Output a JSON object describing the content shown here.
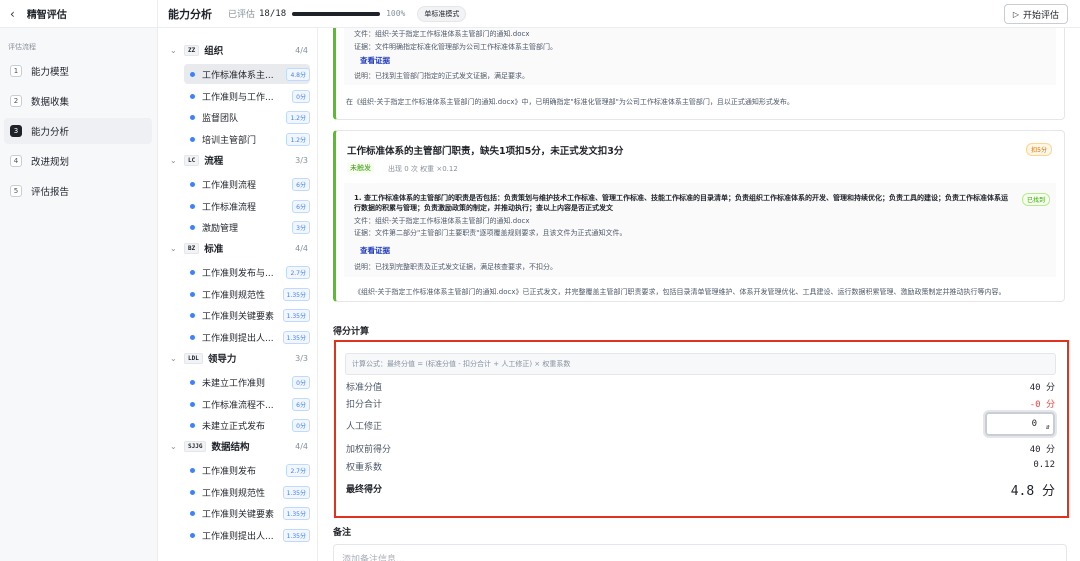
{
  "app": {
    "title": "精智评估"
  },
  "nav": {
    "section_label": "评估流程",
    "steps": [
      {
        "num": "1",
        "label": "能力模型"
      },
      {
        "num": "2",
        "label": "数据收集"
      },
      {
        "num": "3",
        "label": "能力分析"
      },
      {
        "num": "4",
        "label": "改进规划"
      },
      {
        "num": "5",
        "label": "评估报告"
      }
    ],
    "active_step": 2
  },
  "header": {
    "title": "能力分析",
    "evaluated_label": "已评估",
    "evaluated_count": "18/18",
    "progress_pct": "100%",
    "progress": 1.0,
    "mode_badge": "单标准模式",
    "start_button": "开始评估"
  },
  "tree": {
    "groups": [
      {
        "code": "ZZ",
        "name": "组织",
        "count": "4/4",
        "items": [
          {
            "name": "工作标准体系主...",
            "score": "4.8分"
          },
          {
            "name": "工作准则与工作...",
            "score": "0分"
          },
          {
            "name": "监督团队",
            "score": "1.2分"
          },
          {
            "name": "培训主管部门",
            "score": "1.2分"
          }
        ]
      },
      {
        "code": "LC",
        "name": "流程",
        "count": "3/3",
        "items": [
          {
            "name": "工作准则流程",
            "score": "6分"
          },
          {
            "name": "工作标准流程",
            "score": "6分"
          },
          {
            "name": "激励管理",
            "score": "3分"
          }
        ]
      },
      {
        "code": "BZ",
        "name": "标准",
        "count": "4/4",
        "items": [
          {
            "name": "工作准则发布与...",
            "score": "2.7分"
          },
          {
            "name": "工作准则规范性",
            "score": "1.35分"
          },
          {
            "name": "工作准则关键要素",
            "score": "1.35分"
          },
          {
            "name": "工作准则提出人...",
            "score": "1.35分"
          }
        ]
      },
      {
        "code": "LDL",
        "name": "领导力",
        "count": "3/3",
        "items": [
          {
            "name": "未建立工作准则",
            "score": "0分"
          },
          {
            "name": "工作标准流程不...",
            "score": "6分"
          },
          {
            "name": "未建立正式发布",
            "score": "0分"
          }
        ]
      },
      {
        "code": "SJJG",
        "name": "数据结构",
        "count": "4/4",
        "items": [
          {
            "name": "工作准则发布",
            "score": "2.7分"
          },
          {
            "name": "工作准则规范性",
            "score": "1.35分"
          },
          {
            "name": "工作准则关键要素",
            "score": "1.35分"
          },
          {
            "name": "工作准则提出人...",
            "score": "1.35分"
          }
        ]
      }
    ]
  },
  "card1": {
    "file": "文件：组织-关于指定工作标准体系主管部门的通知.docx",
    "evidence": "证据：文件明确指定标准化管理部为公司工作标准体系主管部门。",
    "link": "查看证据",
    "note": "说明：已找到主管部门指定的正式发文证据，满足要求。",
    "summary": "在《组织-关于指定工作标准体系主管部门的通知.docx》中，已明确指定\"标准化管理部\"为公司工作标准体系主管部门，且以正式通知形式发布。"
  },
  "card2": {
    "title": "工作标准体系的主管部门职责，缺失1项扣5分，未正式发文扣3分",
    "deduct_badge": "扣5分",
    "status_badge": "未触发",
    "meta": "出现 0 次  权重 ×0.12",
    "requirement": "1. 查工作标准体系的主管部门的职责是否包括：负责策划与维护技术工作标准、管理工作标准、技能工作标准的目录清单；负责组织工作标准体系的开发、管理和持续优化；负责工具的建设；负责工作标准体系运行数据的积累与管理；负责激励政策的制定，并推动执行；查以上内容是否正式发文",
    "found_badge": "已找到",
    "file": "文件：组织-关于指定工作标准体系主管部门的通知.docx",
    "evidence": "证据：文件第二部分\"主管部门主要职责\"逐项覆盖规则要求，且该文件为正式通知文件。",
    "link": "查看证据",
    "note": "说明：已找到完整职责及正式发文证据，满足核查要求，不扣分。",
    "summary": "《组织-关于指定工作标准体系主管部门的通知.docx》已正式发文，并完整覆盖主管部门职责要求，包括目录清单管理维护、体系开发管理优化、工具建设、运行数据积累管理、激励政策制定并推动执行等内容。"
  },
  "calc": {
    "title": "得分计算",
    "formula": "计算公式：最终分值 = (标准分值 - 扣分合计 + 人工修正) × 权重系数",
    "rows": [
      {
        "label": "标准分值",
        "value": "40 分"
      },
      {
        "label": "扣分合计",
        "value": "-0 分"
      },
      {
        "label": "人工修正",
        "value": "0"
      },
      {
        "label": "加权前得分",
        "value": "40 分"
      },
      {
        "label": "权重系数",
        "value": "0.12"
      }
    ],
    "final_label": "最终得分",
    "final_value": "4.8 分"
  },
  "notes": {
    "title": "备注",
    "placeholder": "添加备注信息..."
  },
  "colors": {
    "accent": "#4080ff",
    "success": "#52c41a",
    "danger": "#f53f3f",
    "highlight_border": "#e0331f"
  }
}
